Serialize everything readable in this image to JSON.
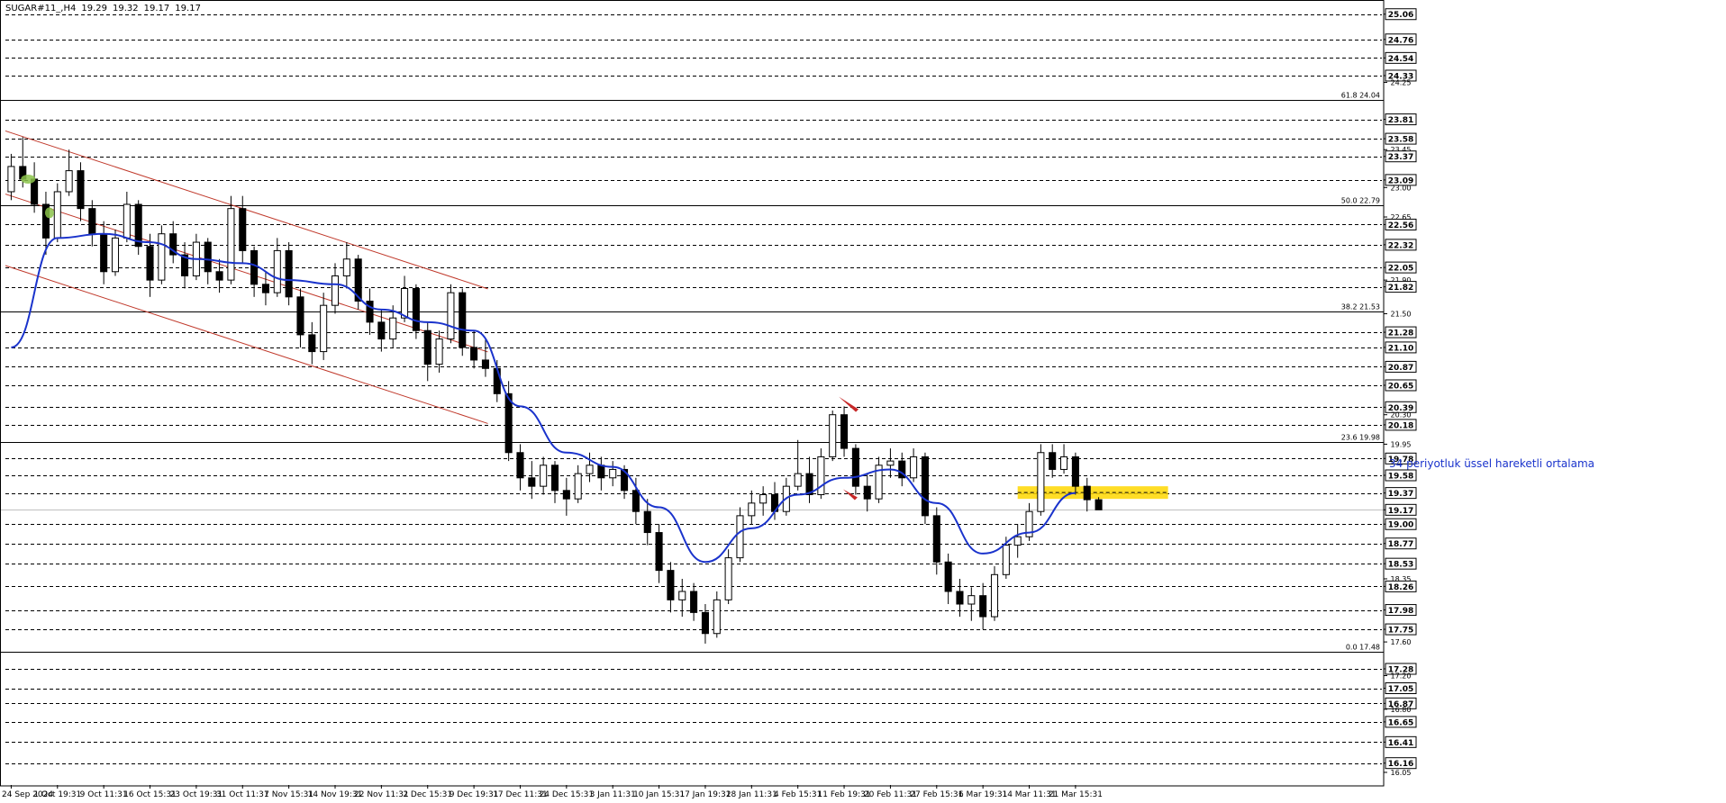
{
  "header": {
    "symbol": "SUGAR#11_,H4",
    "open": "19.29",
    "high": "19.32",
    "low": "19.17",
    "close": "19.17"
  },
  "chart_data": {
    "type": "candlestick",
    "title": "SUGAR#11_,H4",
    "ylim": [
      15.9,
      25.1
    ],
    "grid": true,
    "y_ticks": [
      "25.06",
      "24.76",
      "24.54",
      "24.33",
      "24.25",
      "23.81",
      "23.58",
      "23.45",
      "23.37",
      "23.09",
      "23.00",
      "22.65",
      "22.56",
      "22.32",
      "22.05",
      "21.90",
      "21.82",
      "21.50",
      "21.28",
      "21.10",
      "20.87",
      "20.65",
      "20.39",
      "20.30",
      "20.18",
      "19.95",
      "19.78",
      "19.58",
      "19.37",
      "19.17",
      "19.00",
      "18.77",
      "18.53",
      "18.35",
      "18.26",
      "17.98",
      "17.75",
      "17.60",
      "17.28",
      "17.20",
      "17.05",
      "16.87",
      "16.80",
      "16.65",
      "16.41",
      "16.16",
      "16.05"
    ],
    "y_ticks_boxed": [
      "25.06",
      "24.76",
      "24.54",
      "24.33",
      "23.81",
      "23.58",
      "23.37",
      "23.09",
      "22.56",
      "22.32",
      "22.05",
      "21.82",
      "21.28",
      "21.10",
      "20.87",
      "20.65",
      "20.39",
      "20.18",
      "19.78",
      "19.58",
      "19.37",
      "19.17",
      "19.00",
      "18.77",
      "18.53",
      "18.26",
      "17.98",
      "17.75",
      "17.28",
      "17.05",
      "16.87",
      "16.65",
      "16.41",
      "16.16"
    ],
    "x_ticks": [
      "24 Sep 2024",
      "1 Oct 19:31",
      "9 Oct 11:31",
      "16 Oct 15:31",
      "23 Oct 19:31",
      "31 Oct 11:31",
      "7 Nov 15:31",
      "14 Nov 19:31",
      "22 Nov 11:31",
      "2 Dec 15:31",
      "9 Dec 19:31",
      "17 Dec 11:31",
      "24 Dec 15:31",
      "3 Jan 11:31",
      "10 Jan 15:31",
      "17 Jan 19:31",
      "28 Jan 11:31",
      "4 Feb 15:31",
      "11 Feb 19:31",
      "20 Feb 11:31",
      "27 Feb 15:31",
      "6 Mar 19:31",
      "14 Mar 11:31",
      "21 Mar 15:31"
    ],
    "fibonacci": [
      {
        "label": "61.8 24.04",
        "level": 24.04
      },
      {
        "label": "50.0 22.79",
        "level": 22.79
      },
      {
        "label": "38.2 21.53",
        "level": 21.53
      },
      {
        "label": "23.6 19.98",
        "level": 19.98
      },
      {
        "label": "0.0 17.48",
        "level": 17.48
      }
    ],
    "current_price": 19.17,
    "annotation": "34 periyotluk üssel hareketli ortalama",
    "ema_period": 34,
    "ema_points": [
      {
        "time": "24 Sep 2024",
        "value": 21.1
      },
      {
        "time": "1 Oct 19:31",
        "value": 22.4
      },
      {
        "time": "9 Oct 11:31",
        "value": 22.45
      },
      {
        "time": "16 Oct 15:31",
        "value": 22.35
      },
      {
        "time": "23 Oct 19:31",
        "value": 22.15
      },
      {
        "time": "31 Oct 11:31",
        "value": 22.1
      },
      {
        "time": "7 Nov 15:31",
        "value": 21.9
      },
      {
        "time": "14 Nov 19:31",
        "value": 21.85
      },
      {
        "time": "22 Nov 11:31",
        "value": 21.55
      },
      {
        "time": "2 Dec 15:31",
        "value": 21.4
      },
      {
        "time": "9 Dec 19:31",
        "value": 21.3
      },
      {
        "time": "17 Dec 11:31",
        "value": 20.4
      },
      {
        "time": "24 Dec 15:31",
        "value": 19.85
      },
      {
        "time": "3 Jan 11:31",
        "value": 19.68
      },
      {
        "time": "10 Jan 15:31",
        "value": 19.2
      },
      {
        "time": "17 Jan 19:31",
        "value": 18.55
      },
      {
        "time": "28 Jan 11:31",
        "value": 18.95
      },
      {
        "time": "4 Feb 15:31",
        "value": 19.35
      },
      {
        "time": "11 Feb 19:31",
        "value": 19.55
      },
      {
        "time": "20 Feb 11:31",
        "value": 19.65
      },
      {
        "time": "27 Feb 15:31",
        "value": 19.25
      },
      {
        "time": "6 Mar 19:31",
        "value": 18.65
      },
      {
        "time": "14 Mar 11:31",
        "value": 18.9
      },
      {
        "time": "21 Mar 15:31",
        "value": 19.37
      }
    ],
    "channel_lines": [
      {
        "name": "upper",
        "from": {
          "time": "24 Sep 2024",
          "value": 23.65
        },
        "to": {
          "time": "9 Dec 19:31",
          "value": 21.85
        }
      },
      {
        "name": "middle",
        "from": {
          "time": "24 Sep 2024",
          "value": 22.9
        },
        "to": {
          "time": "9 Dec 19:31",
          "value": 21.1
        }
      },
      {
        "name": "lower",
        "from": {
          "time": "24 Sep 2024",
          "value": 22.05
        },
        "to": {
          "time": "9 Dec 19:31",
          "value": 20.25
        }
      }
    ],
    "highlight_zone": {
      "from": "14 Mar 11:31",
      "to": "21 Mar 15:31",
      "low": 19.3,
      "high": 19.45
    },
    "candles": [
      {
        "time": "24 Sep 2024",
        "open": 22.95,
        "high": 23.4,
        "low": 22.85,
        "close": 23.25
      },
      {
        "time": "",
        "open": 23.25,
        "high": 23.6,
        "low": 23.0,
        "close": 23.1
      },
      {
        "time": "",
        "open": 23.1,
        "high": 23.3,
        "low": 22.7,
        "close": 22.8
      },
      {
        "time": "",
        "open": 22.8,
        "high": 22.95,
        "low": 22.2,
        "close": 22.4
      },
      {
        "time": "1 Oct 19:31",
        "open": 22.4,
        "high": 23.05,
        "low": 22.35,
        "close": 22.95
      },
      {
        "time": "",
        "open": 22.95,
        "high": 23.45,
        "low": 22.9,
        "close": 23.2
      },
      {
        "time": "",
        "open": 23.2,
        "high": 23.3,
        "low": 22.6,
        "close": 22.75
      },
      {
        "time": "",
        "open": 22.75,
        "high": 22.85,
        "low": 22.3,
        "close": 22.45
      },
      {
        "time": "9 Oct 11:31",
        "open": 22.45,
        "high": 22.6,
        "low": 21.85,
        "close": 22.0
      },
      {
        "time": "",
        "open": 22.0,
        "high": 22.5,
        "low": 21.95,
        "close": 22.4
      },
      {
        "time": "",
        "open": 22.4,
        "high": 22.95,
        "low": 22.35,
        "close": 22.8
      },
      {
        "time": "",
        "open": 22.8,
        "high": 22.85,
        "low": 22.2,
        "close": 22.3
      },
      {
        "time": "16 Oct 15:31",
        "open": 22.3,
        "high": 22.45,
        "low": 21.7,
        "close": 21.9
      },
      {
        "time": "",
        "open": 21.9,
        "high": 22.55,
        "low": 21.85,
        "close": 22.45
      },
      {
        "time": "",
        "open": 22.45,
        "high": 22.6,
        "low": 22.1,
        "close": 22.2
      },
      {
        "time": "",
        "open": 22.2,
        "high": 22.35,
        "low": 21.8,
        "close": 21.95
      },
      {
        "time": "23 Oct 19:31",
        "open": 21.95,
        "high": 22.45,
        "low": 21.9,
        "close": 22.35
      },
      {
        "time": "",
        "open": 22.35,
        "high": 22.4,
        "low": 21.85,
        "close": 22.0
      },
      {
        "time": "",
        "open": 22.0,
        "high": 22.15,
        "low": 21.75,
        "close": 21.9
      },
      {
        "time": "",
        "open": 21.9,
        "high": 22.9,
        "low": 21.85,
        "close": 22.75
      },
      {
        "time": "31 Oct 11:31",
        "open": 22.75,
        "high": 22.9,
        "low": 22.1,
        "close": 22.25
      },
      {
        "time": "",
        "open": 22.25,
        "high": 22.3,
        "low": 21.7,
        "close": 21.85
      },
      {
        "time": "",
        "open": 21.85,
        "high": 22.0,
        "low": 21.6,
        "close": 21.75
      },
      {
        "time": "",
        "open": 21.75,
        "high": 22.4,
        "low": 21.7,
        "close": 22.25
      },
      {
        "time": "7 Nov 15:31",
        "open": 22.25,
        "high": 22.35,
        "low": 21.6,
        "close": 21.7
      },
      {
        "time": "",
        "open": 21.7,
        "high": 21.8,
        "low": 21.1,
        "close": 21.25
      },
      {
        "time": "",
        "open": 21.25,
        "high": 21.4,
        "low": 20.9,
        "close": 21.05
      },
      {
        "time": "",
        "open": 21.05,
        "high": 21.75,
        "low": 20.95,
        "close": 21.6
      },
      {
        "time": "14 Nov 19:31",
        "open": 21.6,
        "high": 22.1,
        "low": 21.5,
        "close": 21.95
      },
      {
        "time": "",
        "open": 21.95,
        "high": 22.35,
        "low": 21.8,
        "close": 22.15
      },
      {
        "time": "",
        "open": 22.15,
        "high": 22.2,
        "low": 21.55,
        "close": 21.65
      },
      {
        "time": "",
        "open": 21.65,
        "high": 21.8,
        "low": 21.25,
        "close": 21.4
      },
      {
        "time": "22 Nov 11:31",
        "open": 21.4,
        "high": 21.55,
        "low": 21.05,
        "close": 21.2
      },
      {
        "time": "",
        "open": 21.2,
        "high": 21.6,
        "low": 21.1,
        "close": 21.45
      },
      {
        "time": "",
        "open": 21.45,
        "high": 21.95,
        "low": 21.4,
        "close": 21.8
      },
      {
        "time": "",
        "open": 21.8,
        "high": 21.85,
        "low": 21.2,
        "close": 21.3
      },
      {
        "time": "2 Dec 15:31",
        "open": 21.3,
        "high": 21.4,
        "low": 20.7,
        "close": 20.9
      },
      {
        "time": "",
        "open": 20.9,
        "high": 21.3,
        "low": 20.8,
        "close": 21.2
      },
      {
        "time": "",
        "open": 21.2,
        "high": 21.85,
        "low": 21.15,
        "close": 21.75
      },
      {
        "time": "",
        "open": 21.75,
        "high": 21.8,
        "low": 21.0,
        "close": 21.1
      },
      {
        "time": "9 Dec 19:31",
        "open": 21.1,
        "high": 21.3,
        "low": 20.85,
        "close": 20.95
      },
      {
        "time": "",
        "open": 20.95,
        "high": 21.2,
        "low": 20.75,
        "close": 20.85
      },
      {
        "time": "",
        "open": 20.85,
        "high": 20.95,
        "low": 20.45,
        "close": 20.55
      },
      {
        "time": "",
        "open": 20.55,
        "high": 20.7,
        "low": 19.75,
        "close": 19.85
      },
      {
        "time": "17 Dec 11:31",
        "open": 19.85,
        "high": 19.95,
        "low": 19.4,
        "close": 19.55
      },
      {
        "time": "",
        "open": 19.55,
        "high": 19.75,
        "low": 19.3,
        "close": 19.45
      },
      {
        "time": "",
        "open": 19.45,
        "high": 19.8,
        "low": 19.35,
        "close": 19.7
      },
      {
        "time": "",
        "open": 19.7,
        "high": 19.75,
        "low": 19.25,
        "close": 19.4
      },
      {
        "time": "24 Dec 15:31",
        "open": 19.4,
        "high": 19.55,
        "low": 19.1,
        "close": 19.3
      },
      {
        "time": "",
        "open": 19.3,
        "high": 19.7,
        "low": 19.25,
        "close": 19.6
      },
      {
        "time": "",
        "open": 19.6,
        "high": 19.85,
        "low": 19.5,
        "close": 19.7
      },
      {
        "time": "",
        "open": 19.7,
        "high": 19.8,
        "low": 19.4,
        "close": 19.55
      },
      {
        "time": "3 Jan 11:31",
        "open": 19.55,
        "high": 19.75,
        "low": 19.45,
        "close": 19.65
      },
      {
        "time": "",
        "open": 19.65,
        "high": 19.7,
        "low": 19.3,
        "close": 19.4
      },
      {
        "time": "",
        "open": 19.4,
        "high": 19.55,
        "low": 19.0,
        "close": 19.15
      },
      {
        "time": "",
        "open": 19.15,
        "high": 19.3,
        "low": 18.75,
        "close": 18.9
      },
      {
        "time": "10 Jan 15:31",
        "open": 18.9,
        "high": 19.0,
        "low": 18.3,
        "close": 18.45
      },
      {
        "time": "",
        "open": 18.45,
        "high": 18.55,
        "low": 17.95,
        "close": 18.1
      },
      {
        "time": "",
        "open": 18.1,
        "high": 18.35,
        "low": 17.9,
        "close": 18.2
      },
      {
        "time": "",
        "open": 18.2,
        "high": 18.3,
        "low": 17.85,
        "close": 17.95
      },
      {
        "time": "17 Jan 19:31",
        "open": 17.95,
        "high": 18.05,
        "low": 17.58,
        "close": 17.7
      },
      {
        "time": "",
        "open": 17.7,
        "high": 18.2,
        "low": 17.65,
        "close": 18.1
      },
      {
        "time": "",
        "open": 18.1,
        "high": 18.7,
        "low": 18.05,
        "close": 18.6
      },
      {
        "time": "",
        "open": 18.6,
        "high": 19.2,
        "low": 18.55,
        "close": 19.1
      },
      {
        "time": "28 Jan 11:31",
        "open": 19.1,
        "high": 19.4,
        "low": 19.0,
        "close": 19.25
      },
      {
        "time": "",
        "open": 19.25,
        "high": 19.45,
        "low": 19.1,
        "close": 19.35
      },
      {
        "time": "",
        "open": 19.35,
        "high": 19.5,
        "low": 19.05,
        "close": 19.15
      },
      {
        "time": "",
        "open": 19.15,
        "high": 19.55,
        "low": 19.1,
        "close": 19.45
      },
      {
        "time": "4 Feb 15:31",
        "open": 19.45,
        "high": 20.0,
        "low": 19.4,
        "close": 19.6
      },
      {
        "time": "",
        "open": 19.6,
        "high": 19.8,
        "low": 19.25,
        "close": 19.35
      },
      {
        "time": "",
        "open": 19.35,
        "high": 19.9,
        "low": 19.3,
        "close": 19.8
      },
      {
        "time": "",
        "open": 19.8,
        "high": 20.35,
        "low": 19.75,
        "close": 20.3
      },
      {
        "time": "11 Feb 19:31",
        "open": 20.3,
        "high": 20.4,
        "low": 19.8,
        "close": 19.9
      },
      {
        "time": "",
        "open": 19.9,
        "high": 19.95,
        "low": 19.35,
        "close": 19.45
      },
      {
        "time": "",
        "open": 19.45,
        "high": 19.6,
        "low": 19.15,
        "close": 19.3
      },
      {
        "time": "",
        "open": 19.3,
        "high": 19.8,
        "low": 19.25,
        "close": 19.7
      },
      {
        "time": "20 Feb 11:31",
        "open": 19.7,
        "high": 19.9,
        "low": 19.55,
        "close": 19.75
      },
      {
        "time": "",
        "open": 19.75,
        "high": 19.85,
        "low": 19.45,
        "close": 19.55
      },
      {
        "time": "",
        "open": 19.55,
        "high": 19.9,
        "low": 19.5,
        "close": 19.8
      },
      {
        "time": "",
        "open": 19.8,
        "high": 19.85,
        "low": 19.0,
        "close": 19.1
      },
      {
        "time": "27 Feb 15:31",
        "open": 19.1,
        "high": 19.2,
        "low": 18.4,
        "close": 18.55
      },
      {
        "time": "",
        "open": 18.55,
        "high": 18.65,
        "low": 18.05,
        "close": 18.2
      },
      {
        "time": "",
        "open": 18.2,
        "high": 18.35,
        "low": 17.9,
        "close": 18.05
      },
      {
        "time": "",
        "open": 18.05,
        "high": 18.25,
        "low": 17.85,
        "close": 18.15
      },
      {
        "time": "6 Mar 19:31",
        "open": 18.15,
        "high": 18.3,
        "low": 17.75,
        "close": 17.9
      },
      {
        "time": "",
        "open": 17.9,
        "high": 18.5,
        "low": 17.85,
        "close": 18.4
      },
      {
        "time": "",
        "open": 18.4,
        "high": 18.85,
        "low": 18.35,
        "close": 18.75
      },
      {
        "time": "",
        "open": 18.75,
        "high": 19.0,
        "low": 18.6,
        "close": 18.85
      },
      {
        "time": "14 Mar 11:31",
        "open": 18.85,
        "high": 19.25,
        "low": 18.8,
        "close": 19.15
      },
      {
        "time": "",
        "open": 19.15,
        "high": 19.95,
        "low": 19.1,
        "close": 19.85
      },
      {
        "time": "",
        "open": 19.85,
        "high": 19.95,
        "low": 19.55,
        "close": 19.65
      },
      {
        "time": "",
        "open": 19.65,
        "high": 19.95,
        "low": 19.6,
        "close": 19.8
      },
      {
        "time": "21 Mar 15:31",
        "open": 19.8,
        "high": 19.85,
        "low": 19.35,
        "close": 19.45
      },
      {
        "time": "",
        "open": 19.45,
        "high": 19.55,
        "low": 19.15,
        "close": 19.29
      },
      {
        "time": "",
        "open": 19.29,
        "high": 19.32,
        "low": 19.17,
        "close": 19.17
      }
    ]
  },
  "colors": {
    "background": "#ffffff",
    "candle": "#000000",
    "ema": "#1a33cc",
    "channel": "#c0392b",
    "fibonacci": "#000000",
    "highlight": "#ffd700",
    "annotation": "#1a33cc"
  }
}
